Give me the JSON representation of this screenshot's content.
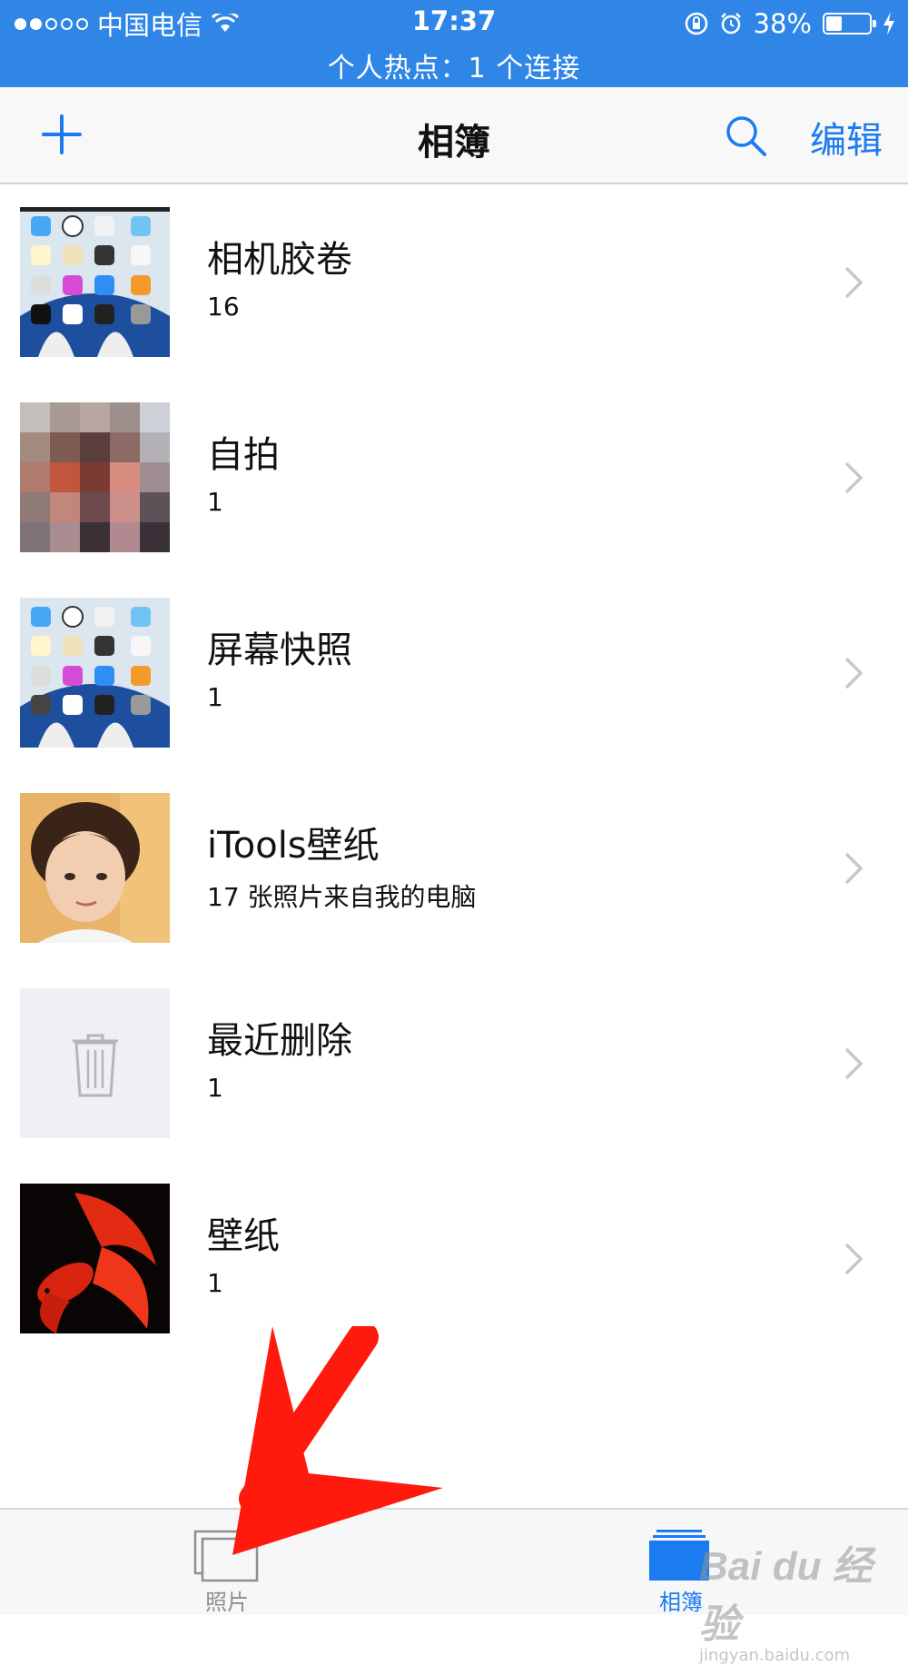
{
  "status_bar": {
    "carrier": "中国电信",
    "time": "17:37",
    "battery_percent": "38%",
    "battery_level": 0.38,
    "hotspot_text": "个人热点：1 个连接"
  },
  "nav": {
    "title": "相簿",
    "edit_label": "编辑",
    "accent_color": "#1a7cf0"
  },
  "albums": [
    {
      "name": "相机胶卷",
      "count": "16",
      "thumb": "home-screen-screenshot"
    },
    {
      "name": "自拍",
      "count": "1",
      "thumb": "pixelated-selfie"
    },
    {
      "name": "屏幕快照",
      "count": "1",
      "thumb": "home-screen-screenshot"
    },
    {
      "name": "iTools壁纸",
      "count": "17 张照片来自我的电脑",
      "thumb": "child-portrait"
    },
    {
      "name": "最近删除",
      "count": "1",
      "thumb": "trash-icon"
    },
    {
      "name": "壁纸",
      "count": "1",
      "thumb": "red-betta-fish"
    }
  ],
  "tab_bar": {
    "photos_label": "照片",
    "albums_label": "相簿",
    "selected": "相簿"
  },
  "watermark": {
    "logo": "Bai du 经验",
    "url": "jingyan.baidu.com"
  }
}
